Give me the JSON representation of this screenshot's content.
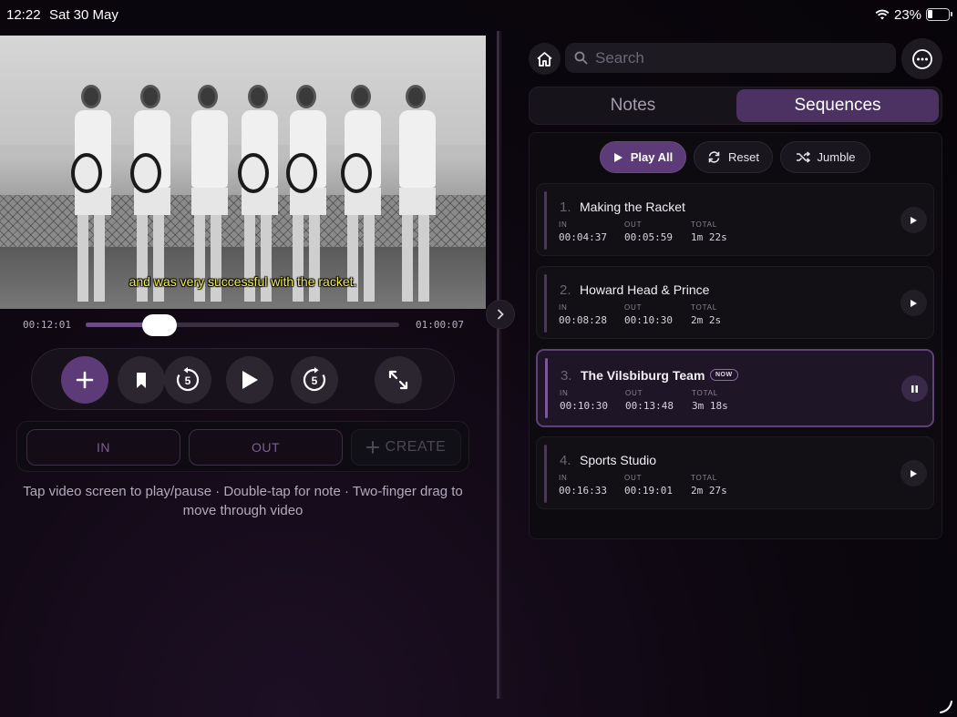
{
  "status_bar": {
    "time": "12:22",
    "date": "Sat 30 May",
    "battery": "23%"
  },
  "video": {
    "subtitle": "and was very successful with the racket.",
    "current_time": "00:12:01",
    "end_time": "01:00:07",
    "progress_fraction": 0.2
  },
  "controls": {
    "skip_back_seconds": "5",
    "skip_forward_seconds": "5"
  },
  "markers": {
    "in_label": "IN",
    "out_label": "OUT",
    "create_label": "CREATE"
  },
  "hint": "Tap video screen to play/pause · Double-tap for note · Two-finger drag to move through video",
  "search": {
    "placeholder": "Search"
  },
  "tabs": [
    {
      "label": "Notes",
      "active": false
    },
    {
      "label": "Sequences",
      "active": true
    }
  ],
  "actions": {
    "play_all": "Play All",
    "reset": "Reset",
    "jumble": "Jumble"
  },
  "sequence_labels": {
    "in": "IN",
    "out": "OUT",
    "total": "TOTAL",
    "now": "NOW"
  },
  "sequences": [
    {
      "num": "1.",
      "title": "Making the Racket",
      "in": "00:04:37",
      "out": "00:05:59",
      "total": "1m 22s",
      "playing": false
    },
    {
      "num": "2.",
      "title": "Howard Head & Prince",
      "in": "00:08:28",
      "out": "00:10:30",
      "total": "2m 2s",
      "playing": false
    },
    {
      "num": "3.",
      "title": "The Vilsbiburg Team",
      "in": "00:10:30",
      "out": "00:13:48",
      "total": "3m 18s",
      "playing": true
    },
    {
      "num": "4.",
      "title": "Sports Studio",
      "in": "00:16:33",
      "out": "00:19:01",
      "total": "2m 27s",
      "playing": false
    }
  ],
  "colors": {
    "accent": "#5c3b78",
    "subtitle": "#f2ee4a",
    "background": "#0c070f"
  }
}
